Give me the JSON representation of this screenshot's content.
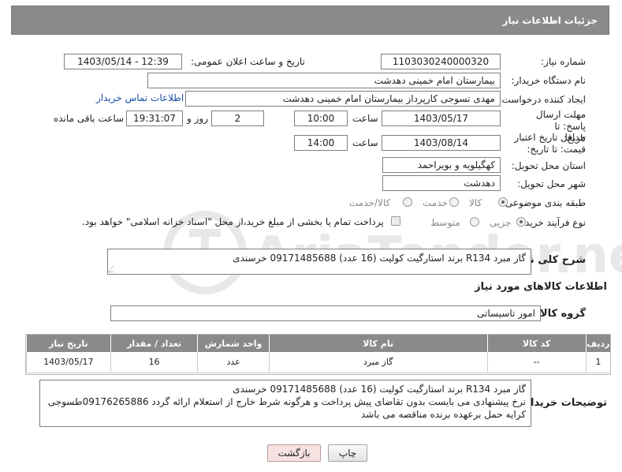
{
  "header": {
    "title": "جزئیات اطلاعات نیاز"
  },
  "fields": {
    "need_number_label": "شماره نیاز:",
    "need_number": "1103030240000320",
    "announce_label": "تاریخ و ساعت اعلان عمومی:",
    "announce_value": "1403/05/14 - 12:39",
    "buyer_org_label": "نام دستگاه خریدار:",
    "buyer_org": "بیمارستان امام خمینی دهدشت",
    "creator_label": "ایجاد کننده درخواست:",
    "creator": "مهدی تسوجی کارپرداز بیمارستان امام خمینی دهدشت",
    "contact_link": "اطلاعات تماس خریدار",
    "reply_deadline_label": "مهلت ارسال پاسخ: تا تاریخ:",
    "reply_date": "1403/05/17",
    "time_label": "ساعت",
    "reply_time": "10:00",
    "days_value": "2",
    "days_label": "روز و",
    "remaining_time": "19:31:07",
    "remaining_label": "ساعت باقی مانده",
    "validity_label": "حداقل تاریخ اعتبار قیمت: تا تاریخ:",
    "validity_date": "1403/08/14",
    "validity_time_label": "ساعت",
    "validity_time": "14:00",
    "province_label": "استان محل تحویل:",
    "province": "کهگیلویه و بویراحمد",
    "city_label": "شهر محل تحویل:",
    "city": "دهدشت",
    "category_label": "طبقه بندی موضوعی:",
    "category_options": [
      "کالا",
      "خدمت",
      "کالا/خدمت"
    ],
    "purchase_type_label": "نوع فرآیند خرید :",
    "purchase_options": [
      "جزیی",
      "متوسط"
    ],
    "payment_note": "پرداخت تمام یا بخشی از مبلغ خرید،از محل \"اسناد خزانه اسلامی\" خواهد بود.",
    "description_label": "شرح کلی نیاز:",
    "description": "گاز مبرد  R134    برند استارگیت کولیت (16 عدد) 09171485688 خرسندی"
  },
  "goods_section": {
    "title": "اطلاعات کالاهای مورد نیاز",
    "group_label": "گروه کالا:",
    "group": "امور تاسیساتی"
  },
  "table": {
    "headers": [
      "ردیف",
      "کد کالا",
      "نام کالا",
      "واحد شمارش",
      "تعداد / مقدار",
      "تاریخ نیاز"
    ],
    "rows": [
      [
        "1",
        "--",
        "گاز مبرد",
        "عدد",
        "16",
        "1403/05/17"
      ]
    ]
  },
  "buyer_notes": {
    "label": "توضیحات خریدار:",
    "line1": "گاز مبرد  R134    برند استارگیت کولیت (16 عدد) 09171485688 خرسندی",
    "line2": "نرخ پیشنهادی می بایست بدون تقاضای پیش پرداخت و هرگونه شرط خارج از استعلام ارائه گردد 09176265886طسوجی",
    "line3": "کرایه حمل برعهده برنده مناقصه می باشد"
  },
  "buttons": {
    "print": "چاپ",
    "back": "بازگشت"
  },
  "watermark": {
    "text": "AriaTender.neT"
  }
}
